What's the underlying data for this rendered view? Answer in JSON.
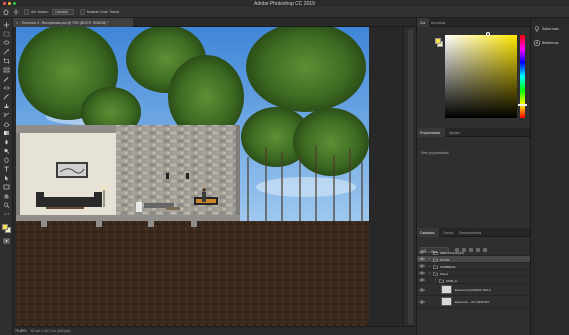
{
  "app": {
    "title": "Adobe Photoshop CC 2019"
  },
  "options_bar": {
    "auto_select_label": "Sel. Autom.:",
    "auto_select_value": "Camada",
    "transform_label": "Mostrar Contr. Transf."
  },
  "document": {
    "tab_label": "Exercício 3 - Recuperada.psd @ 79% (NOITE, RGB/16) *",
    "zoom": "78,85%",
    "info": "60 cm x 30,7 cm (300 ppi)"
  },
  "panels": {
    "color_tab": "Cor",
    "swatches_tab": "Amostras",
    "properties_tab": "Propriedades",
    "adjustments_tab": "Ajustes",
    "properties_empty": "Sem propriedades",
    "layers_tab": "Camadas",
    "channels_tab": "Canais",
    "paths_tab": "Demarcadores",
    "kind_label": "Tipo",
    "blend_mode": "Normal",
    "opacity_label": "Opacidade:",
    "opacity_value": "100%",
    "lock_label": "Bloq.:",
    "fill_label": "Preench.:",
    "fill_value": "100%"
  },
  "layers": [
    {
      "name": "IDENTIFICAÇÃO",
      "type": "group",
      "indent": 0,
      "selected": false
    },
    {
      "name": "NOITE",
      "type": "group",
      "indent": 0,
      "selected": true
    },
    {
      "name": "SOMBRAS",
      "type": "group",
      "indent": 0,
      "selected": false
    },
    {
      "name": "SALA",
      "type": "group",
      "indent": 0,
      "selected": false
    },
    {
      "name": "MOB_LI",
      "type": "group",
      "indent": 1,
      "selected": false
    },
    {
      "name": "Estrutura QUADRO SALA",
      "type": "layer",
      "indent": 2,
      "selected": false
    },
    {
      "name": "Estrutura ...AO CENTRO",
      "type": "layer",
      "indent": 2,
      "selected": false
    }
  ],
  "side_panel": {
    "learn_label": "Saiba mais",
    "libraries_label": "Bibliotecas"
  },
  "colors": {
    "foreground": "#f6e04a",
    "background": "#f4f0c4",
    "picker_hue": "#ffe600"
  }
}
